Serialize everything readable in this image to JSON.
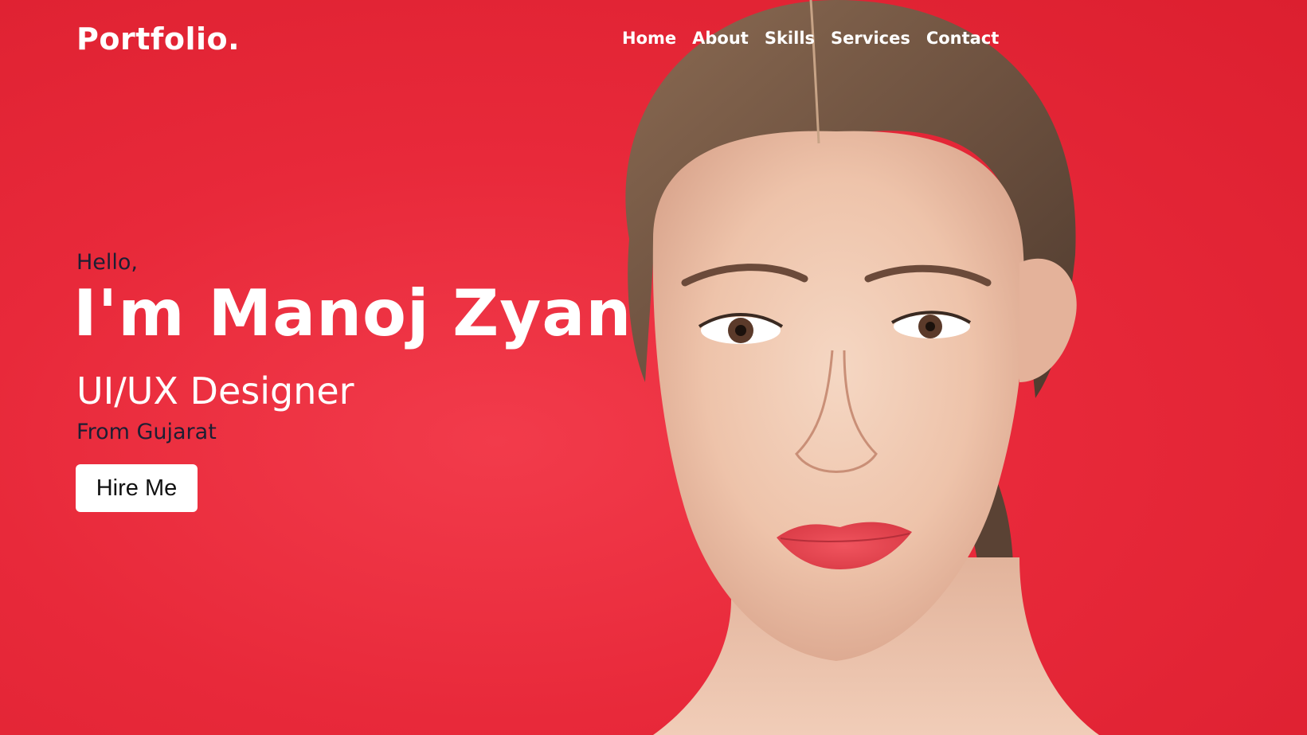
{
  "header": {
    "logo": "Portfolio.",
    "nav": [
      "Home",
      "About",
      "Skills",
      "Services",
      "Contact"
    ]
  },
  "hero": {
    "greeting": "Hello,",
    "name": "I'm Manoj Zyan",
    "role": "UI/UX Designer",
    "origin": "From Gujarat",
    "cta_label": "Hire Me"
  },
  "colors": {
    "background": "#e8293a",
    "text_light": "#ffffff",
    "text_dark": "#1c1f33",
    "button_bg": "#ffffff"
  },
  "icons": {
    "portrait": "portrait-photo"
  }
}
